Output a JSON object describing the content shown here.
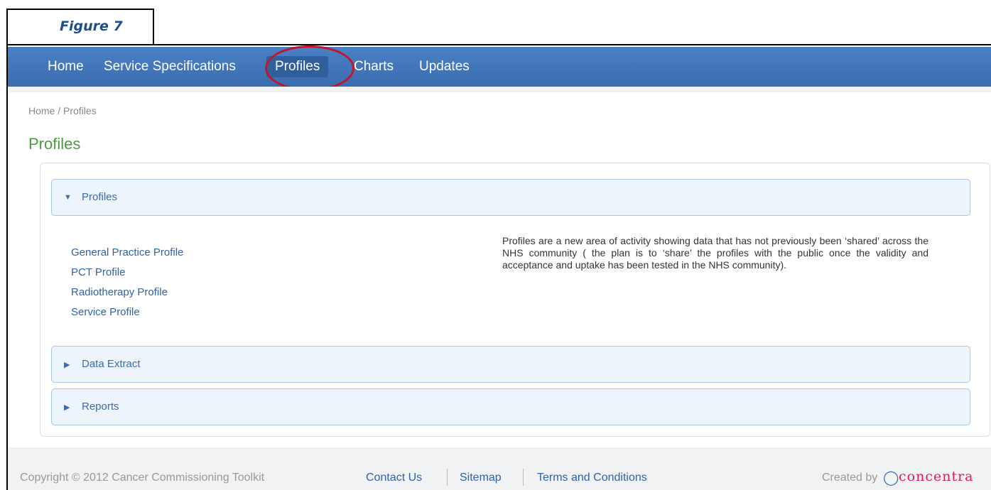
{
  "figure_label": "Figure 7",
  "nav": {
    "items": [
      {
        "label": "Home"
      },
      {
        "label": "Service Specifications"
      },
      {
        "label": "Profiles"
      },
      {
        "label": "Charts"
      },
      {
        "label": "Updates"
      }
    ],
    "active": "Profiles"
  },
  "breadcrumb": "Home / Profiles",
  "page_title": "Profiles",
  "accordion": {
    "profiles": {
      "label": "Profiles",
      "links": [
        "General Practice Profile",
        "PCT Profile",
        "Radiotherapy Profile",
        "Service Profile"
      ],
      "description": "Profiles are a new area of activity showing data that has not previously been ‘shared’ across the NHS community ( the plan is to ‘share’ the profiles with the public once the validity and acceptance and uptake has been tested in the NHS community)."
    },
    "data_extract": {
      "label": "Data Extract"
    },
    "reports": {
      "label": "Reports"
    }
  },
  "footer": {
    "copyright": "Copyright © 2012 Cancer Commissioning Toolkit",
    "links": [
      "Contact Us",
      "Sitemap",
      "Terms and Conditions"
    ],
    "created_by": "Created by",
    "logo_text": "concentra"
  },
  "colors": {
    "nav_bg": "#3a6db0",
    "title_green": "#4a9a3f",
    "highlight_red": "#c0152a",
    "logo_pink": "#e0195a"
  }
}
